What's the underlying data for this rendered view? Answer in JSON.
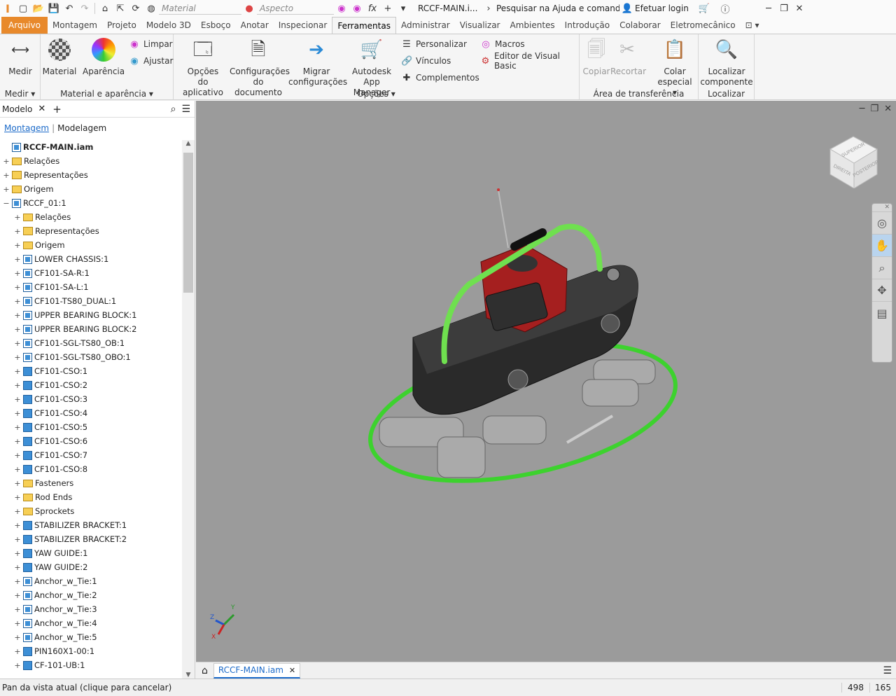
{
  "qat": {
    "material_placeholder": "Material",
    "appearance_placeholder": "Aspecto",
    "doc_title": "RCCF-MAIN.i...",
    "search_text": "Pesquisar na Ajuda e comandos...",
    "login": "Efetuar login"
  },
  "tabs": [
    "Arquivo",
    "Montagem",
    "Projeto",
    "Modelo 3D",
    "Esboço",
    "Anotar",
    "Inspecionar",
    "Ferramentas",
    "Administrar",
    "Visualizar",
    "Ambientes",
    "Introdução",
    "Colaborar",
    "Eletromecânico"
  ],
  "active_tab": "Ferramentas",
  "ribbon": {
    "medir": {
      "btn": "Medir",
      "label": "Medir"
    },
    "material": {
      "material": "Material",
      "aparencia": "Aparência",
      "limpar": "Limpar",
      "ajustar": "Ajustar",
      "label": "Material e aparência"
    },
    "opcoes": {
      "opcoes_app_1": "Opções",
      "opcoes_app_2": "do aplicativo",
      "config_doc_1": "Configurações",
      "config_doc_2": "do documento",
      "migrar_1": "Migrar",
      "migrar_2": "configurações",
      "autodesk_1": "Autodesk",
      "autodesk_2": "App Manager",
      "personalizar": "Personalizar",
      "vinculos": "Vínculos",
      "complementos": "Complementos",
      "macros": "Macros",
      "editor_vb": "Editor de Visual Basic",
      "label": "Opções"
    },
    "transfer": {
      "copiar": "Copiar",
      "recortar": "Recortar",
      "colar_1": "Colar",
      "colar_2": "especial",
      "label": "Área de transferência"
    },
    "localizar": {
      "btn_1": "Localizar",
      "btn_2": "componente",
      "label": "Localizar"
    }
  },
  "browser": {
    "title": "Modelo",
    "subtab_active": "Montagem",
    "subtab_other": "Modelagem",
    "items": [
      {
        "label": "RCCF-MAIN.iam",
        "indent": 0,
        "icon": "asm",
        "pm": "",
        "bold": true
      },
      {
        "label": "Relações",
        "indent": 0,
        "icon": "folder",
        "pm": "+"
      },
      {
        "label": "Representações",
        "indent": 0,
        "icon": "rep",
        "pm": "+"
      },
      {
        "label": "Origem",
        "indent": 0,
        "icon": "folder",
        "pm": "+"
      },
      {
        "label": "RCCF_01:1",
        "indent": 0,
        "icon": "asm",
        "pm": "−"
      },
      {
        "label": "Relações",
        "indent": 1,
        "icon": "folder",
        "pm": "+"
      },
      {
        "label": "Representações",
        "indent": 1,
        "icon": "rep",
        "pm": "+"
      },
      {
        "label": "Origem",
        "indent": 1,
        "icon": "folder",
        "pm": "+"
      },
      {
        "label": "LOWER CHASSIS:1",
        "indent": 1,
        "icon": "asm",
        "pm": "+"
      },
      {
        "label": "CF101-SA-R:1",
        "indent": 1,
        "icon": "asm2",
        "pm": "+"
      },
      {
        "label": "CF101-SA-L:1",
        "indent": 1,
        "icon": "asm2",
        "pm": "+"
      },
      {
        "label": "CF101-TS80_DUAL:1",
        "indent": 1,
        "icon": "asm",
        "pm": "+"
      },
      {
        "label": "UPPER BEARING BLOCK:1",
        "indent": 1,
        "icon": "asm",
        "pm": "+"
      },
      {
        "label": "UPPER BEARING BLOCK:2",
        "indent": 1,
        "icon": "asm",
        "pm": "+"
      },
      {
        "label": "CF101-SGL-TS80_OB:1",
        "indent": 1,
        "icon": "asm",
        "pm": "+"
      },
      {
        "label": "CF101-SGL-TS80_OBO:1",
        "indent": 1,
        "icon": "asm",
        "pm": "+"
      },
      {
        "label": "CF101-CSO:1",
        "indent": 1,
        "icon": "part",
        "pm": "+"
      },
      {
        "label": "CF101-CSO:2",
        "indent": 1,
        "icon": "part",
        "pm": "+"
      },
      {
        "label": "CF101-CSO:3",
        "indent": 1,
        "icon": "part",
        "pm": "+"
      },
      {
        "label": "CF101-CSO:4",
        "indent": 1,
        "icon": "part",
        "pm": "+"
      },
      {
        "label": "CF101-CSO:5",
        "indent": 1,
        "icon": "part",
        "pm": "+"
      },
      {
        "label": "CF101-CSO:6",
        "indent": 1,
        "icon": "part",
        "pm": "+"
      },
      {
        "label": "CF101-CSO:7",
        "indent": 1,
        "icon": "part",
        "pm": "+"
      },
      {
        "label": "CF101-CSO:8",
        "indent": 1,
        "icon": "part",
        "pm": "+"
      },
      {
        "label": "Fasteners",
        "indent": 1,
        "icon": "folder",
        "pm": "+"
      },
      {
        "label": "Rod Ends",
        "indent": 1,
        "icon": "folder",
        "pm": "+"
      },
      {
        "label": "Sprockets",
        "indent": 1,
        "icon": "folder",
        "pm": "+"
      },
      {
        "label": "STABILIZER BRACKET:1",
        "indent": 1,
        "icon": "part",
        "pm": "+"
      },
      {
        "label": "STABILIZER BRACKET:2",
        "indent": 1,
        "icon": "part",
        "pm": "+"
      },
      {
        "label": "YAW GUIDE:1",
        "indent": 1,
        "icon": "part",
        "pm": "+"
      },
      {
        "label": "YAW GUIDE:2",
        "indent": 1,
        "icon": "part",
        "pm": "+"
      },
      {
        "label": "Anchor_w_Tie:1",
        "indent": 1,
        "icon": "asm",
        "pm": "+"
      },
      {
        "label": "Anchor_w_Tie:2",
        "indent": 1,
        "icon": "asm",
        "pm": "+"
      },
      {
        "label": "Anchor_w_Tie:3",
        "indent": 1,
        "icon": "asm",
        "pm": "+"
      },
      {
        "label": "Anchor_w_Tie:4",
        "indent": 1,
        "icon": "asm",
        "pm": "+"
      },
      {
        "label": "Anchor_w_Tie:5",
        "indent": 1,
        "icon": "asm",
        "pm": "+"
      },
      {
        "label": "PIN160X1-00:1",
        "indent": 1,
        "icon": "part",
        "pm": "+"
      },
      {
        "label": "CF-101-UB:1",
        "indent": 1,
        "icon": "part",
        "pm": "+"
      }
    ]
  },
  "viewcube": {
    "top": "SUPERIOR",
    "front": "DIREITA",
    "side": "POSTERIOR"
  },
  "doc_tab": "RCCF-MAIN.iam",
  "status": {
    "text": "Pan da vista atual (clique para cancelar)",
    "x": "498",
    "y": "165"
  },
  "colors": {
    "accent": "#e8892b",
    "link": "#1b6ac9",
    "model_green": "#3dd22e",
    "model_red": "#a51f1f"
  }
}
